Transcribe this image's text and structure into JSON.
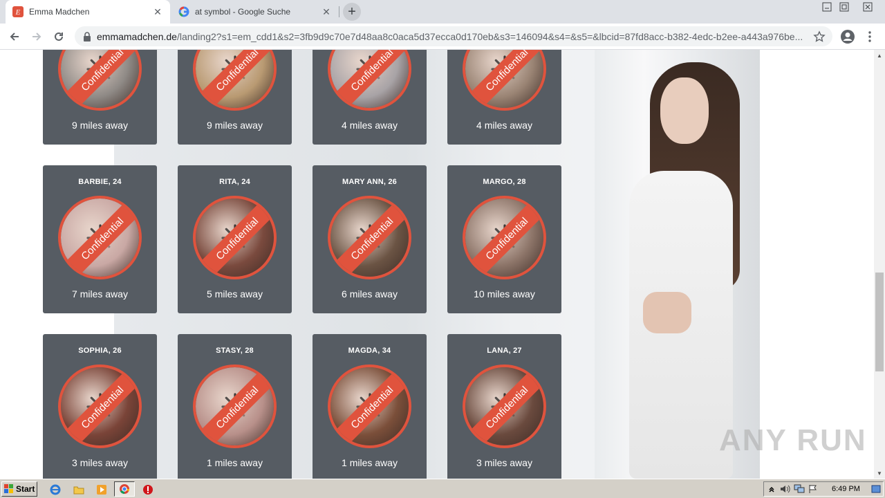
{
  "browser": {
    "tabs": [
      {
        "title": "Emma Madchen",
        "favicon": "emma-favicon",
        "active": true
      },
      {
        "title": "at symbol - Google Suche",
        "favicon": "google-favicon",
        "active": false
      }
    ],
    "address": {
      "host": "emmamadchen.de",
      "path": "/landing2?s1=em_cdd1&s2=3fb9d9c70e7d48aa8c0aca5d37ecca0d170eb&s3=146094&s4=&s5=&lbcid=87fd8acc-b382-4edc-b2ee-a443a976be..."
    },
    "icons": {
      "back": "back-arrow-icon",
      "forward": "forward-arrow-icon",
      "reload": "reload-icon",
      "lock": "lock-icon",
      "bookmark": "star-icon",
      "profile": "account-icon",
      "menu": "kebab-menu-icon"
    }
  },
  "profiles": {
    "badge_text": "Confidential",
    "rows": [
      [
        {
          "name": "",
          "distance": "9 miles away",
          "tint": "#8f8a86"
        },
        {
          "name": "",
          "distance": "9 miles away",
          "tint": "#b99a72"
        },
        {
          "name": "",
          "distance": "4 miles away",
          "tint": "#a8a3a6"
        },
        {
          "name": "",
          "distance": "4 miles away",
          "tint": "#9a8474"
        }
      ],
      [
        {
          "name": "BARBIE, 24",
          "distance": "7 miles away",
          "tint": "#c9a8a4"
        },
        {
          "name": "RITA, 24",
          "distance": "5 miles away",
          "tint": "#7a4a3e"
        },
        {
          "name": "MARY ANN, 26",
          "distance": "6 miles away",
          "tint": "#6b5444"
        },
        {
          "name": "MARGO, 28",
          "distance": "10 miles away",
          "tint": "#8c7468"
        }
      ],
      [
        {
          "name": "SOPHIA, 26",
          "distance": "3 miles away",
          "tint": "#7a4438"
        },
        {
          "name": "STASY, 28",
          "distance": "1 miles away",
          "tint": "#b8908a"
        },
        {
          "name": "MAGDA, 34",
          "distance": "1 miles away",
          "tint": "#7b4f3a"
        },
        {
          "name": "LANA, 27",
          "distance": "3 miles away",
          "tint": "#6a4a3e"
        }
      ]
    ]
  },
  "watermark": "ANY RUN",
  "taskbar": {
    "start_label": "Start",
    "quick_launch": [
      "ie-icon",
      "folder-icon",
      "media-player-icon",
      "chrome-icon",
      "antivirus-icon"
    ],
    "clock": "6:49 PM"
  },
  "colors": {
    "accent": "#e0533d",
    "card": "#565c63"
  }
}
